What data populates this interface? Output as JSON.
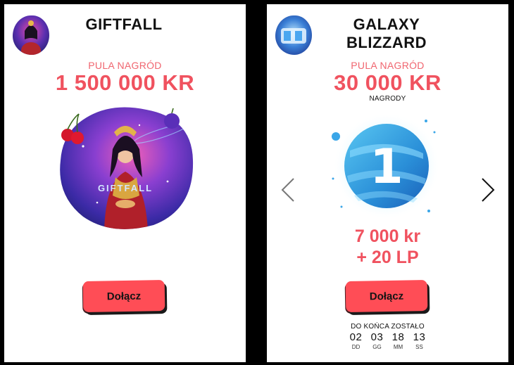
{
  "cards": [
    {
      "title": "GIFTFALL",
      "pool_label": "PULA NAGRÓD",
      "pool_value": "1 500 000 KR",
      "hero_logo": "GIFTFALL",
      "join_label": "Dołącz"
    },
    {
      "title_line1": "GALAXY",
      "title_line2": "BLIZZARD",
      "pool_label": "PULA NAGRÓD",
      "pool_value": "30 000 KR",
      "prizes_label": "NAGRODY",
      "rank_number": "1",
      "prize_amount": "7 000 kr",
      "prize_points": "+ 20 LP",
      "join_label": "Dołącz",
      "countdown_label": "DO KOŃCA ZOSTAŁO",
      "countdown": [
        {
          "value": "02",
          "unit": "DD"
        },
        {
          "value": "03",
          "unit": "GG"
        },
        {
          "value": "18",
          "unit": "MM"
        },
        {
          "value": "13",
          "unit": "SS"
        }
      ]
    }
  ],
  "icons": {
    "prev": "chevron-left-icon",
    "next": "chevron-right-icon"
  },
  "colors": {
    "accent": "#f0525f",
    "button": "#ff4d56",
    "background": "#000000",
    "card": "#ffffff"
  }
}
